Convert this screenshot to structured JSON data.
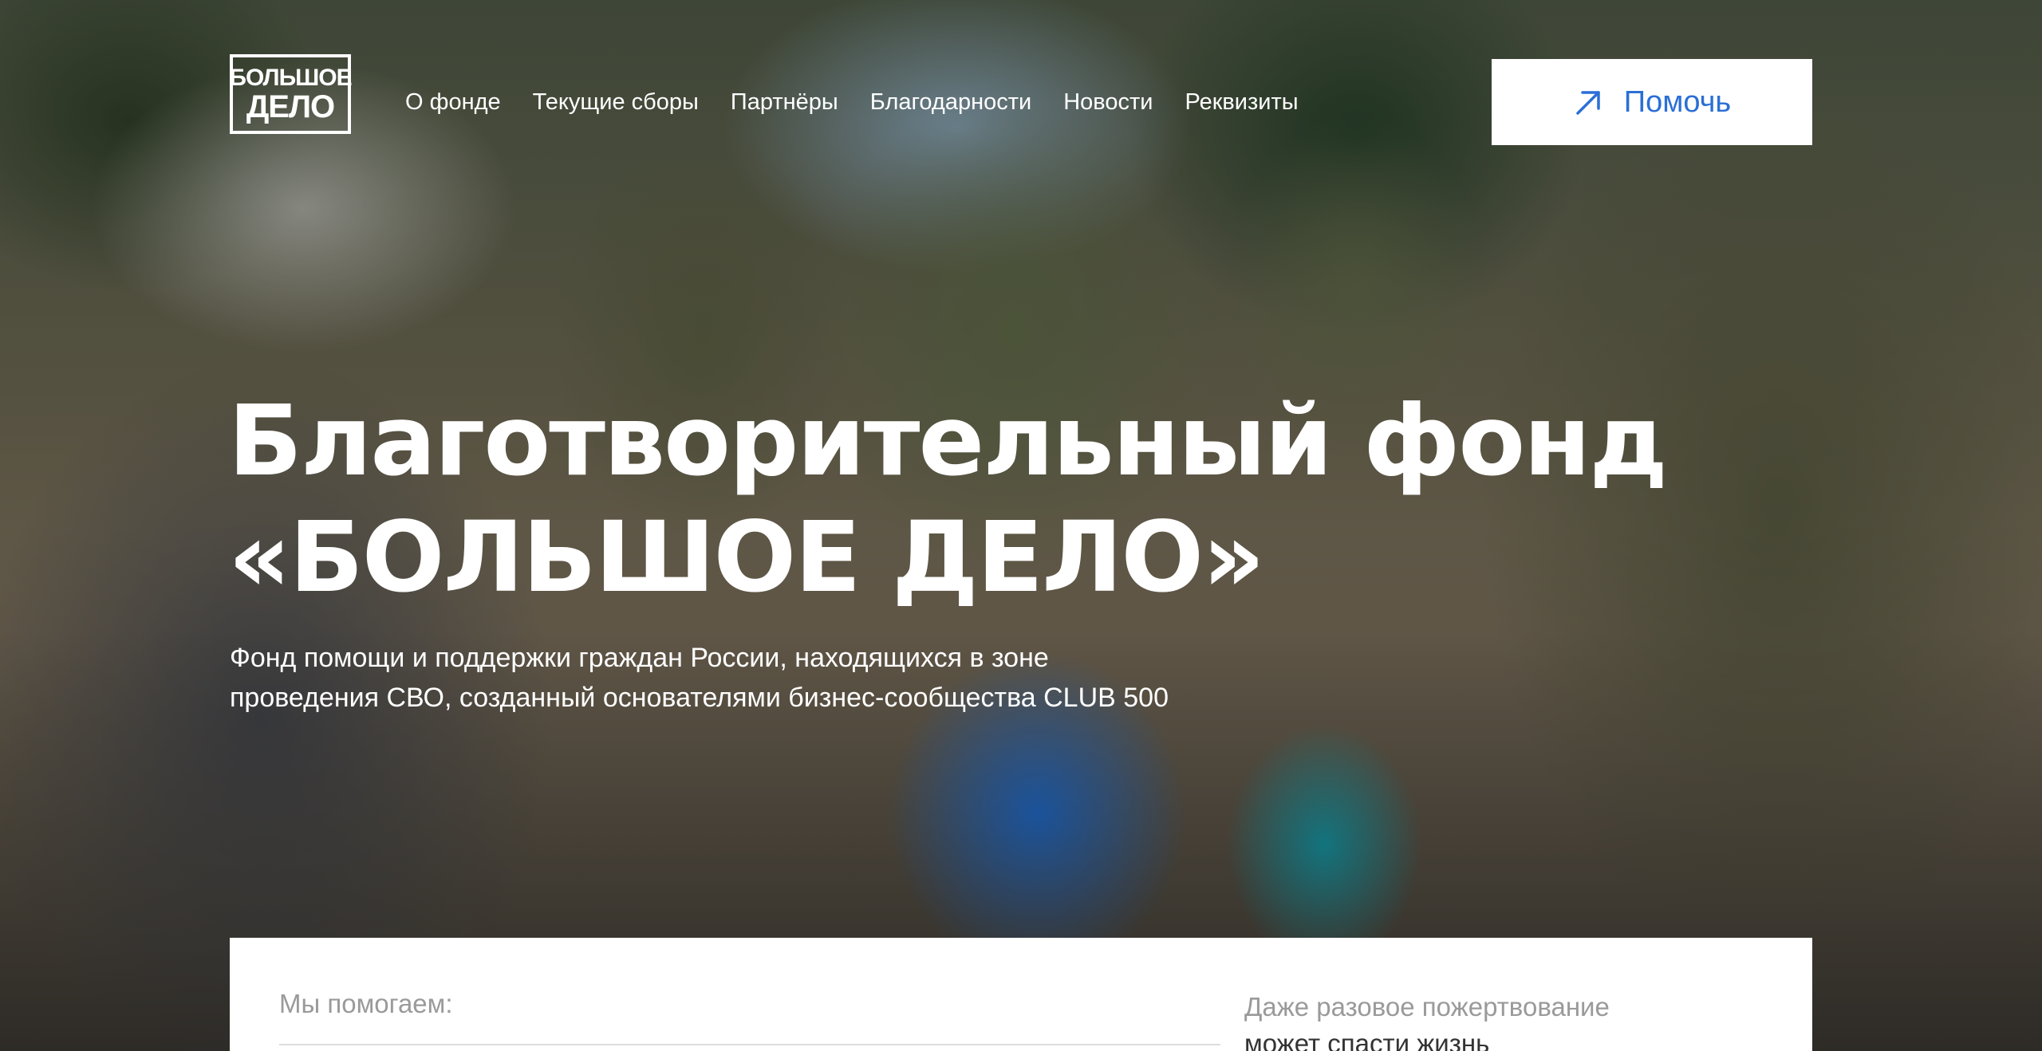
{
  "header": {
    "logo": {
      "line1": "БОЛЬШОЕ",
      "line2": "ДЕЛО"
    },
    "nav": [
      {
        "label": "О фонде"
      },
      {
        "label": "Текущие сборы"
      },
      {
        "label": "Партнёры"
      },
      {
        "label": "Благодарности"
      },
      {
        "label": "Новости"
      },
      {
        "label": "Реквизиты"
      }
    ],
    "help_button": {
      "label": "Помочь",
      "icon": "arrow-up-right-icon"
    }
  },
  "hero": {
    "title_line1": "Благотворительный фонд",
    "title_line2": "«БОЛЬШОЕ ДЕЛО»",
    "subtitle_line1": "Фонд помощи и поддержки граждан России, находящихся в зоне",
    "subtitle_line2": "проведения СВО, созданный основателями бизнес-сообщества CLUB 500"
  },
  "info_card": {
    "we_help_label": "Мы помогаем:",
    "donation_line1": "Даже разовое пожертвование",
    "donation_line2": "может спасти жизнь"
  },
  "colors": {
    "accent": "#2b6fd6",
    "text_light": "#ffffff",
    "muted": "#9a9a9a"
  }
}
